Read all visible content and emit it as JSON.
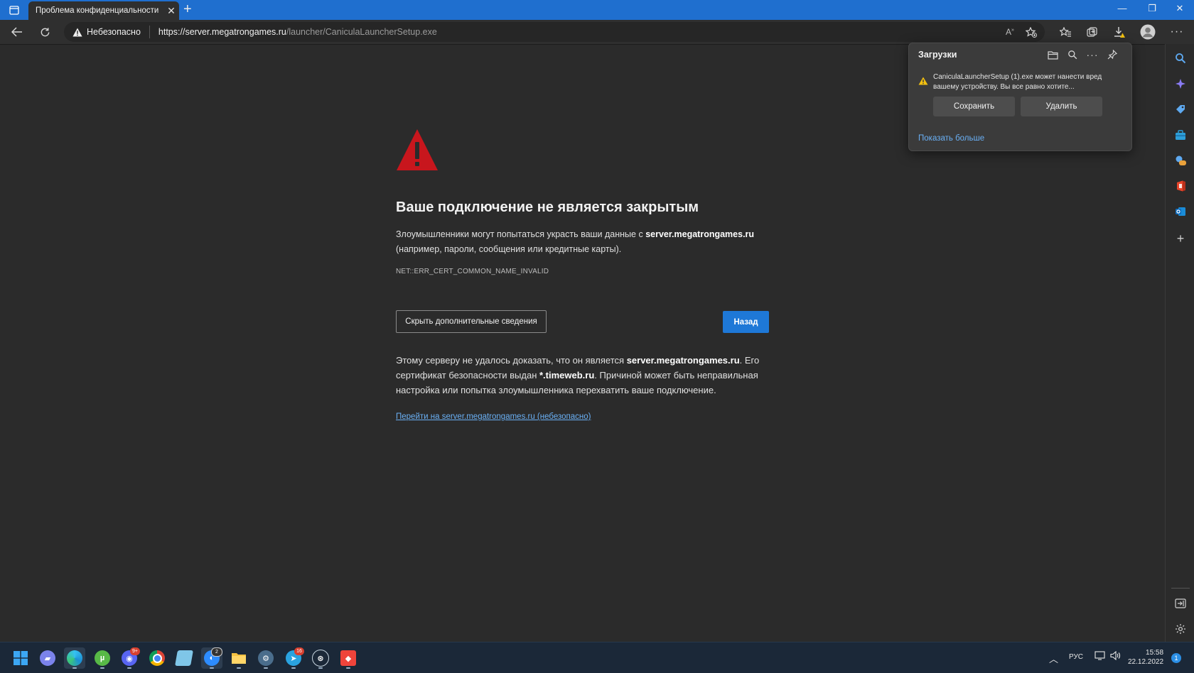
{
  "browser": {
    "tab_title": "Проблема конфиденциальности",
    "tab_close": "✕",
    "new_tab": "+",
    "window_controls": {
      "minimize": "—",
      "restore": "❐",
      "close": "✕"
    },
    "security_label": "Небезопасно",
    "url_scheme": "https://",
    "url_host": "server.megatrongames.ru",
    "url_path": "/launcher/CaniculaLauncherSetup.exe"
  },
  "error_page": {
    "title": "Ваше подключение не является закрытым",
    "desc_prefix": "Злоумышленники могут попытаться украсть ваши данные с ",
    "desc_host": "server.megatrongames.ru",
    "desc_suffix": " (например, пароли, сообщения или кредитные карты).",
    "error_code": "NET::ERR_CERT_COMMON_NAME_INVALID",
    "hide_details_button": "Скрыть дополнительные сведения",
    "back_button": "Назад",
    "details_part1": "Этому серверу не удалось доказать, что он является ",
    "details_host": "server.megatrongames.ru",
    "details_part2": ". Его сертификат безопасности выдан ",
    "details_issuer": "*.timeweb.ru",
    "details_part3": ". Причиной может быть неправильная настройка или попытка злоумышленника перехватить ваше подключение.",
    "proceed_link": "Перейти на server.megatrongames.ru (небезопасно)"
  },
  "downloads": {
    "title": "Загрузки",
    "message": "CaniculaLauncherSetup (1).exe может нанести вред вашему устройству. Вы все равно хотите...",
    "keep_button": "Сохранить",
    "delete_button": "Удалить",
    "show_more": "Показать больше"
  },
  "taskbar": {
    "badges": {
      "discord": "9+",
      "zoom": "2",
      "telegram": "16"
    },
    "language": "РУС",
    "time": "15:58",
    "date": "22.12.2022",
    "notifications": "1"
  },
  "colors": {
    "accent": "#1e78d7",
    "link": "#6ab0f5",
    "warning_red": "#c8161d",
    "titlebar": "#1f6fcf",
    "page_bg": "#2b2b2b"
  }
}
